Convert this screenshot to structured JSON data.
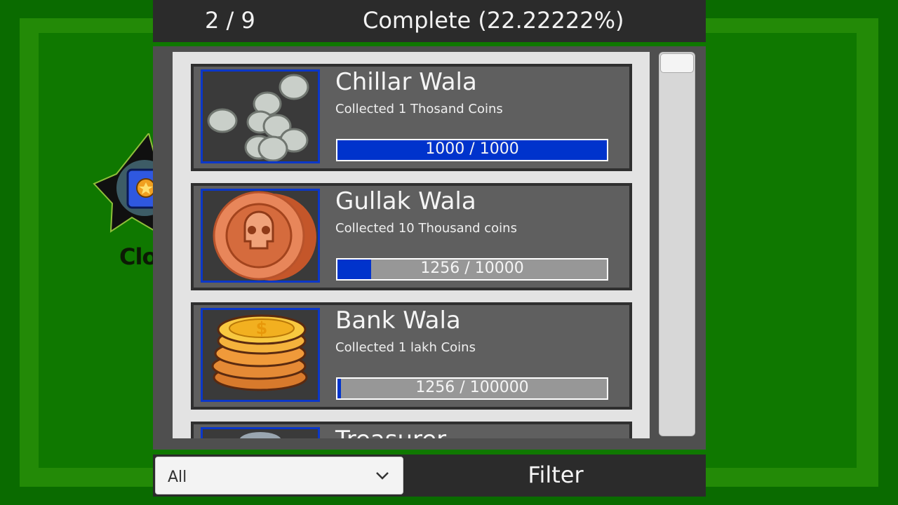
{
  "header": {
    "counter": "2 / 9",
    "complete": "Complete (22.22222%)"
  },
  "background": {
    "partial_button_text": "Clo"
  },
  "achievements": [
    {
      "title": "Chillar Wala",
      "description": "Collected 1 Thosand Coins",
      "progress_label": "1000 / 1000",
      "progress": 1.0,
      "icon": "silver-coins-icon"
    },
    {
      "title": "Gullak Wala",
      "description": "Collected 10 Thousand coins",
      "progress_label": "1256 / 10000",
      "progress": 0.1256,
      "icon": "skull-coin-icon"
    },
    {
      "title": "Bank Wala",
      "description": "Collected 1 lakh Coins",
      "progress_label": "1256 / 100000",
      "progress": 0.01256,
      "icon": "gold-coin-stack-icon"
    },
    {
      "title": "Treasurer",
      "description": "",
      "progress_label": "",
      "progress": 0,
      "icon": "treasure-icon"
    }
  ],
  "filter": {
    "dropdown_value": "All",
    "button_label": "Filter"
  },
  "colors": {
    "progress_fill": "#0033cc",
    "thumb_border": "#0b37c9",
    "background": "#0a6b00"
  }
}
